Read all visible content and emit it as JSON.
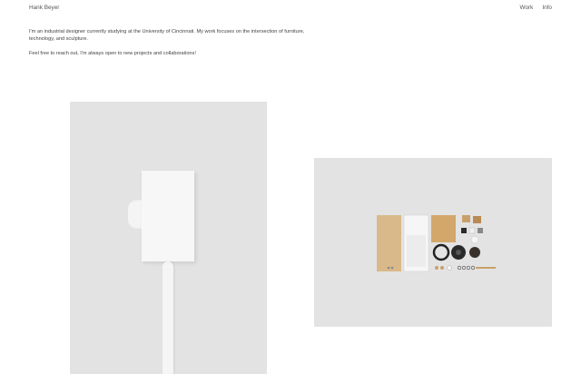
{
  "header": {
    "site_name": "Hank Beyer",
    "nav": [
      {
        "label": "Work"
      },
      {
        "label": "Info"
      }
    ]
  },
  "bio": {
    "intro": "I'm an industrial designer currently studying at the University of Cincinnati. My work focuses on the intersection of furniture, technology, and sculpture.",
    "contact": "Feel free to reach out, I'm always open to new projects and collaborations!"
  },
  "projects": [
    {
      "subject": "white speaker on pole",
      "background": "#e3e3e3"
    },
    {
      "subject": "speaker components laid out",
      "background": "#e3e3e3"
    }
  ]
}
